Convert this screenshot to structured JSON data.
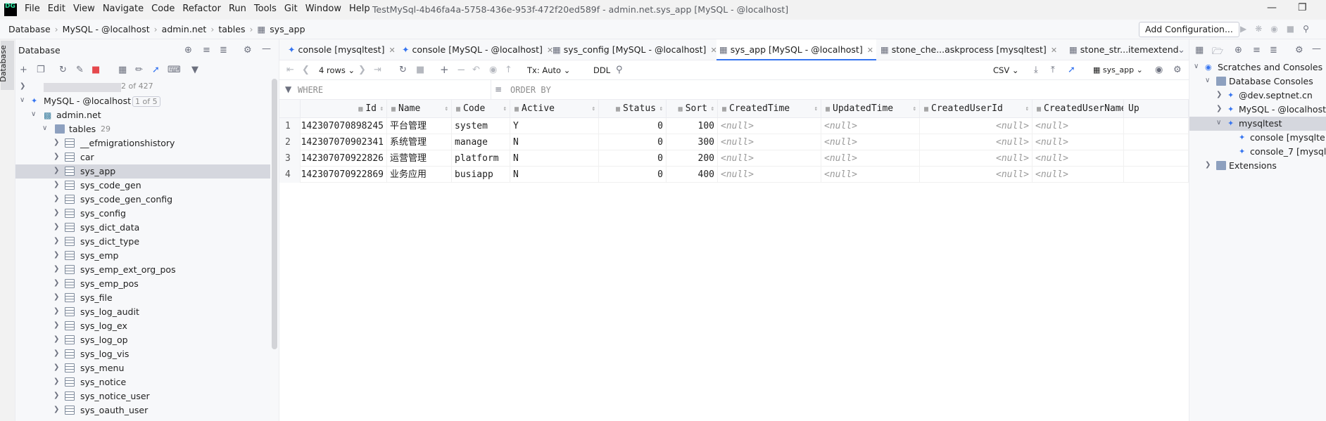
{
  "app": {
    "logo": "DG",
    "title": "TestMySql-4b46fa4a-5758-436e-953f-472f20ed589f - admin.net.sys_app [MySQL - @localhost]",
    "menu": [
      "File",
      "Edit",
      "View",
      "Navigate",
      "Code",
      "Refactor",
      "Run",
      "Tools",
      "Git",
      "Window",
      "Help"
    ]
  },
  "breadcrumb": [
    "Database",
    "MySQL - @localhost",
    "admin.net",
    "tables",
    "sys_app"
  ],
  "toolbar": {
    "add_configuration": "Add Configuration..."
  },
  "left_strip": {
    "tab": "Database"
  },
  "db_panel": {
    "title": "Database",
    "pager": "2 of 427",
    "connection": {
      "label": "MySQL - @localhost",
      "badge": "1 of 5"
    },
    "schema": "admin.net",
    "tables_folder": {
      "label": "tables",
      "count": "29"
    },
    "tables": [
      "__efmigrationshistory",
      "car",
      "sys_app",
      "sys_code_gen",
      "sys_code_gen_config",
      "sys_config",
      "sys_dict_data",
      "sys_dict_type",
      "sys_emp",
      "sys_emp_ext_org_pos",
      "sys_emp_pos",
      "sys_file",
      "sys_log_audit",
      "sys_log_ex",
      "sys_log_op",
      "sys_log_vis",
      "sys_menu",
      "sys_notice",
      "sys_notice_user",
      "sys_oauth_user"
    ],
    "selected_table": "sys_app"
  },
  "editor_tabs": [
    {
      "label": "console [mysqltest]",
      "active": false
    },
    {
      "label": "console [MySQL - @localhost]",
      "active": false
    },
    {
      "label": "sys_config [MySQL - @localhost]",
      "active": false
    },
    {
      "label": "sys_app [MySQL - @localhost]",
      "active": true
    },
    {
      "label": "stone_che...askprocess [mysqltest]",
      "active": false
    },
    {
      "label": "stone_str...itemextend",
      "active": false
    }
  ],
  "grid_toolbar": {
    "rows_label": "4 rows",
    "tx_label": "Tx: Auto",
    "ddl_label": "DDL",
    "export_label": "CSV",
    "schema_label": "sys_app"
  },
  "filter": {
    "where": "WHERE",
    "order_by": "ORDER BY"
  },
  "grid": {
    "columns": [
      "Id",
      "Name",
      "Code",
      "Active",
      "Status",
      "Sort",
      "CreatedTime",
      "UpdatedTime",
      "CreatedUserId",
      "CreatedUserName",
      "Up"
    ],
    "rows": [
      {
        "n": "1",
        "Id": "142307070898245",
        "Name": "平台管理",
        "Code": "system",
        "Active": "Y",
        "Status": "0",
        "Sort": "100",
        "CreatedTime": "<null>",
        "UpdatedTime": "<null>",
        "CreatedUserId": "<null>",
        "CreatedUserName": "<null>"
      },
      {
        "n": "2",
        "Id": "142307070902341",
        "Name": "系统管理",
        "Code": "manage",
        "Active": "N",
        "Status": "0",
        "Sort": "300",
        "CreatedTime": "<null>",
        "UpdatedTime": "<null>",
        "CreatedUserId": "<null>",
        "CreatedUserName": "<null>"
      },
      {
        "n": "3",
        "Id": "142307070922826",
        "Name": "运营管理",
        "Code": "platform",
        "Active": "N",
        "Status": "0",
        "Sort": "200",
        "CreatedTime": "<null>",
        "UpdatedTime": "<null>",
        "CreatedUserId": "<null>",
        "CreatedUserName": "<null>"
      },
      {
        "n": "4",
        "Id": "142307070922869",
        "Name": "业务应用",
        "Code": "busiapp",
        "Active": "N",
        "Status": "0",
        "Sort": "400",
        "CreatedTime": "<null>",
        "UpdatedTime": "<null>",
        "CreatedUserId": "<null>",
        "CreatedUserName": "<null>"
      }
    ]
  },
  "right_panel": {
    "root": "Scratches and Consoles",
    "db_consoles": "Database Consoles",
    "items": [
      "@dev.septnet.cn",
      "MySQL - @localhost",
      "mysqltest"
    ],
    "consoles": [
      "console [mysqlte",
      "console_7 [mysql"
    ],
    "extensions": "Extensions"
  },
  "colors": {
    "accent": "#3574f0",
    "selection": "#d5d7de",
    "panel_bg": "#f7f8fa"
  }
}
